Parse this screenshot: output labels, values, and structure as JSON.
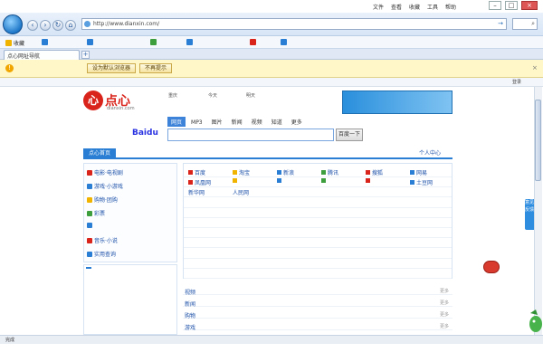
{
  "window": {
    "title": "",
    "menu": [
      "文件",
      "查看",
      "收藏",
      "工具",
      "帮助"
    ]
  },
  "address": {
    "url": "http://www.dianxin.com/"
  },
  "favorites": [
    {
      "label": "收藏",
      "color": "#f0b400"
    },
    {
      "label": "",
      "color": "#2a7fd4"
    },
    {
      "label": "",
      "color": "#2a7fd4"
    },
    {
      "label": "",
      "color": "#3d9e3d"
    },
    {
      "label": "",
      "color": "#2a7fd4"
    },
    {
      "label": "",
      "color": "#d9241b"
    },
    {
      "label": "",
      "color": "#2a7fd4"
    }
  ],
  "tab": {
    "label": "点心网址导航"
  },
  "infobar": {
    "message": "",
    "primary_button": "设为默认浏览器",
    "secondary_button": "不再提示"
  },
  "commandbar": {
    "left": "",
    "right": "登录"
  },
  "site": {
    "brand_logo_char": "心",
    "brand_name": "点心",
    "brand_url": "dianxin.com",
    "weather": [
      {
        "line1": "重庆",
        "line2": "",
        "line3": ""
      },
      {
        "line1": "今天",
        "line2": "",
        "line3": ""
      },
      {
        "line1": "明天",
        "line2": "",
        "line3": ""
      },
      {
        "line1": "",
        "line2": "",
        "line3": ""
      }
    ],
    "ad": {
      "line1": "",
      "line2": "",
      "line3": ""
    },
    "search": {
      "logo": "Baidu",
      "tabs": [
        "网页",
        "MP3",
        "图片",
        "新闻",
        "视频",
        "知道",
        "更多"
      ],
      "button": "百度一下",
      "links": [
        "",
        ""
      ]
    },
    "nav_tabs": [
      "点心首页",
      "",
      "",
      "个人中心"
    ],
    "sidebar": [
      {
        "label": "电影·电视剧",
        "sub": "",
        "color": "#d9241b"
      },
      {
        "label": "游戏·小游戏",
        "sub": "",
        "color": "#2a7fd4"
      },
      {
        "label": "购物·团购",
        "sub": "",
        "color": "#f0b400"
      },
      {
        "label": "彩票",
        "sub": "",
        "color": "#3d9e3d"
      },
      {
        "label": "",
        "sub": "",
        "color": "#2a7fd4"
      },
      {
        "label": "音乐·小说",
        "sub": "",
        "color": "#d9241b"
      },
      {
        "label": "实用查询",
        "sub": "",
        "color": "#2a7fd4"
      }
    ],
    "grid": [
      [
        "百度",
        "淘宝",
        "新浪",
        "腾讯",
        "搜狐",
        "网易"
      ],
      [
        "凤凰网",
        "",
        "",
        "",
        "",
        "土豆网"
      ],
      [
        "新华网",
        "人民网",
        "",
        "",
        "",
        ""
      ],
      [
        "",
        "",
        "",
        "",
        "",
        ""
      ],
      [
        "",
        "",
        "",
        "",
        "",
        ""
      ],
      [
        "",
        "",
        "",
        "",
        "",
        ""
      ],
      [
        "",
        "",
        "",
        "",
        "",
        ""
      ],
      [
        "",
        "",
        "",
        "",
        "",
        ""
      ],
      [
        "",
        "",
        "",
        "",
        "",
        ""
      ],
      [
        "",
        "",
        "",
        "",
        "",
        ""
      ],
      [
        "",
        "",
        "",
        "",
        "",
        ""
      ]
    ],
    "news_tabs": [
      "",
      "",
      "",
      ""
    ],
    "news": [
      "",
      "",
      "",
      "",
      "",
      ""
    ],
    "categories": [
      {
        "label": "视频",
        "links": [
          "",
          "",
          "",
          "",
          "",
          ""
        ],
        "more": "更多"
      },
      {
        "label": "新闻",
        "links": [
          "",
          "",
          "",
          "",
          "",
          ""
        ],
        "more": "更多"
      },
      {
        "label": "购物",
        "links": [
          "",
          "",
          "",
          "",
          "",
          ""
        ],
        "more": "更多"
      },
      {
        "label": "游戏",
        "links": [
          "",
          "",
          "",
          "",
          "",
          ""
        ],
        "more": "更多"
      }
    ],
    "feedback": "意见反馈",
    "news_float": ""
  },
  "status": {
    "left": "完成",
    "right": ""
  }
}
